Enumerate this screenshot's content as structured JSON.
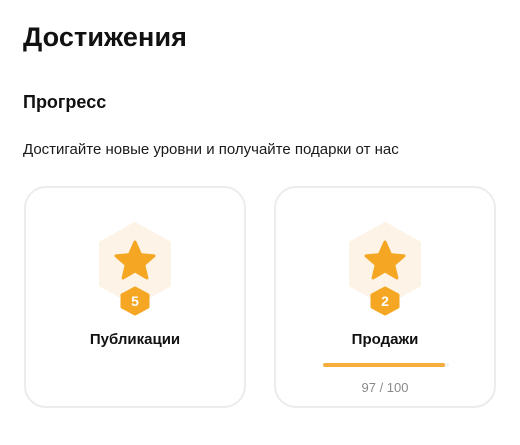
{
  "page": {
    "title": "Достижения"
  },
  "progress_section": {
    "title": "Прогресс",
    "subtitle": "Достигайте новые уровни и получайте подарки от нас"
  },
  "cards": [
    {
      "label": "Публикации",
      "level": "5",
      "icon": "star-icon"
    },
    {
      "label": "Продажи",
      "level": "2",
      "icon": "star-icon",
      "progress": {
        "current": 97,
        "max": 100,
        "text": "97 / 100"
      }
    }
  ],
  "colors": {
    "accent": "#f5a623",
    "badge_bg": "#fdf3e7",
    "progress_fill": "#f5ad3c"
  }
}
